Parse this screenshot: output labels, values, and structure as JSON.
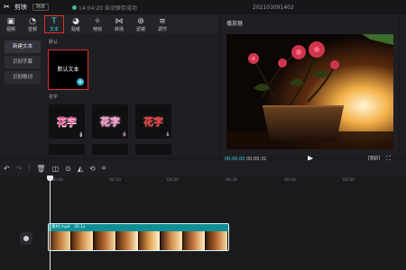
{
  "app": {
    "name": "剪映",
    "tag": "简单",
    "status": "14:04:20 自动保存成功",
    "window_title": "202103091402"
  },
  "toolbar": [
    {
      "label": "视频",
      "icon": "video-icon"
    },
    {
      "label": "音频",
      "icon": "audio-icon"
    },
    {
      "label": "文本",
      "icon": "text-icon",
      "active": true
    },
    {
      "label": "贴纸",
      "icon": "sticker-icon"
    },
    {
      "label": "特效",
      "icon": "effect-icon"
    },
    {
      "label": "转场",
      "icon": "transition-icon"
    },
    {
      "label": "滤镜",
      "icon": "filter-icon"
    },
    {
      "label": "调节",
      "icon": "adjust-icon"
    }
  ],
  "left_nav": [
    "新建文本",
    "识别字幕",
    "识别歌词"
  ],
  "panel": {
    "default_section": "默认",
    "default_card_text": "默认文本",
    "flower_section": "花字",
    "flower_samples": [
      "花字",
      "花字",
      "花字"
    ]
  },
  "player": {
    "title": "播放器",
    "current_time": "00:00:00",
    "total_time": "00:00:31",
    "ratio_label": "原始"
  },
  "timeline": {
    "ruler_ticks": [
      "00:00",
      "00:10",
      "00:20",
      "00:30",
      "00:40",
      "00:50"
    ],
    "clip_label": "素材.mp4　30.1s"
  },
  "colors": {
    "accent": "#4ad7e6",
    "highlight_red": "#e0302b",
    "clip_teal": "#0f8f95"
  }
}
